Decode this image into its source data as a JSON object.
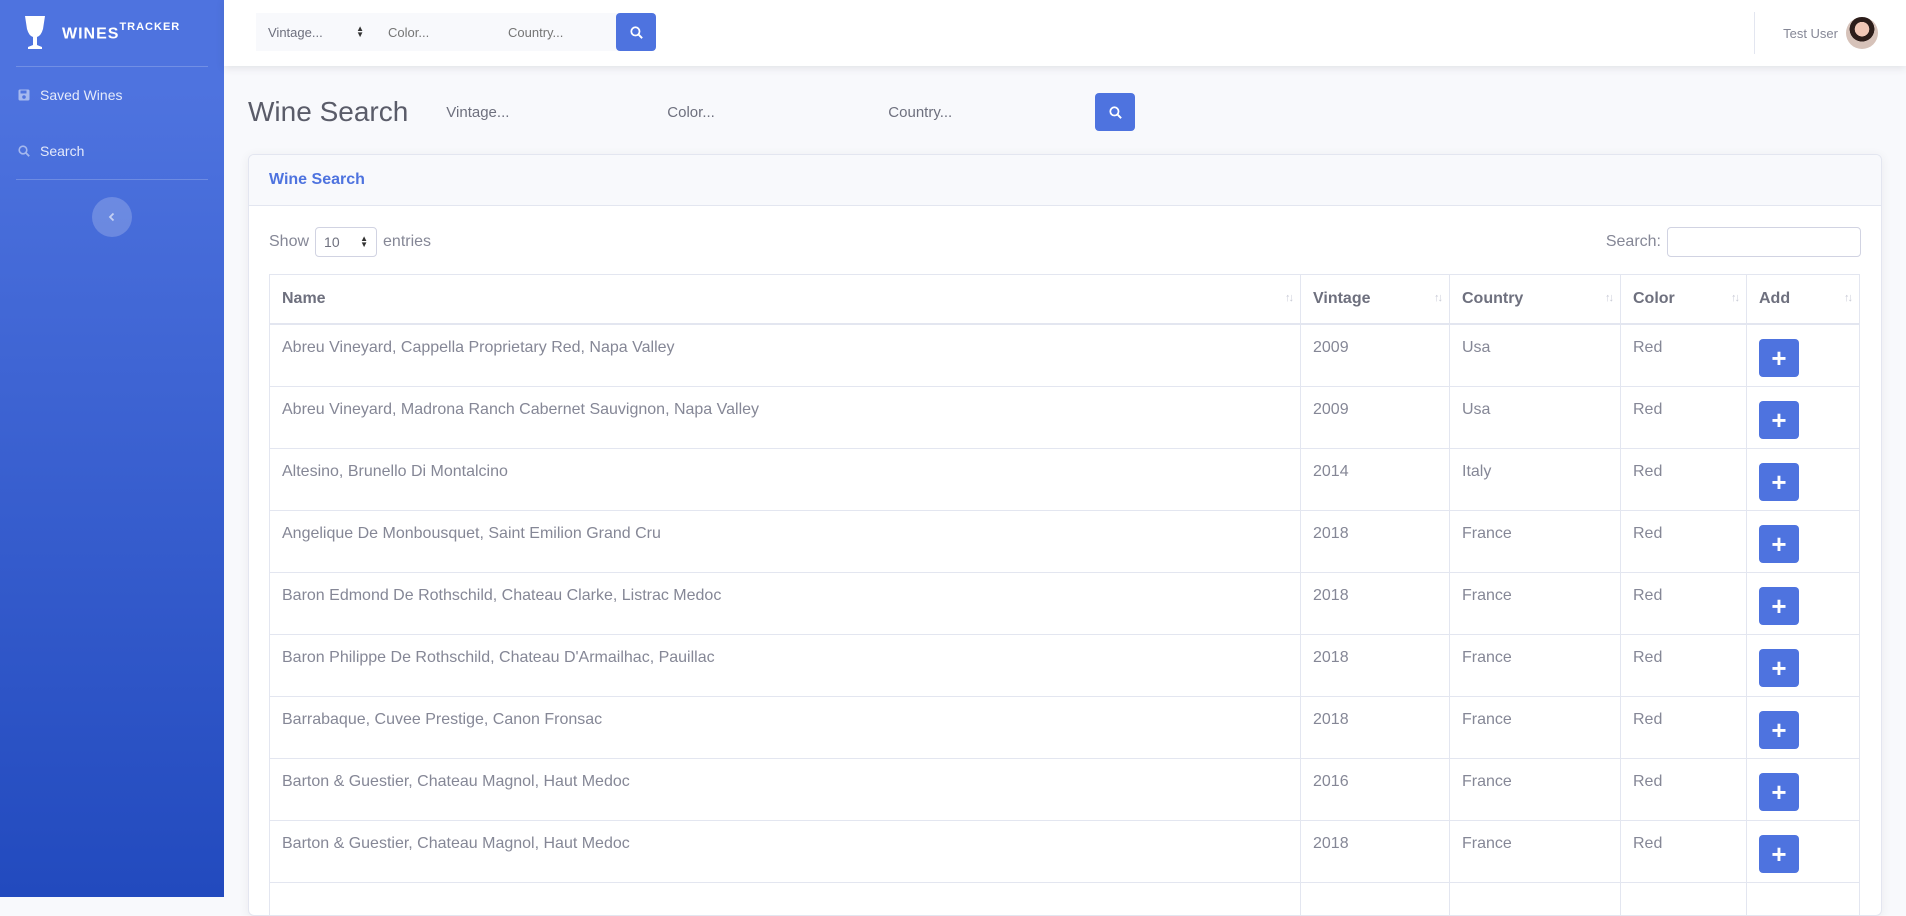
{
  "brand": {
    "name": "WINES",
    "sup": "TRACKER"
  },
  "sidebar": {
    "items": [
      {
        "label": "Saved Wines",
        "icon": "save-icon"
      },
      {
        "label": "Search",
        "icon": "search-icon"
      }
    ]
  },
  "topbar": {
    "vintage_placeholder": "Vintage...",
    "color_placeholder": "Color...",
    "country_placeholder": "Country...",
    "user_name": "Test User"
  },
  "heading": {
    "title": "Wine Search",
    "vintage_placeholder": "Vintage...",
    "color_placeholder": "Color...",
    "country_placeholder": "Country..."
  },
  "card": {
    "title": "Wine Search",
    "show_label": "Show",
    "entries_label": "entries",
    "page_length": "10",
    "search_label": "Search:"
  },
  "table": {
    "headers": [
      "Name",
      "Vintage",
      "Country",
      "Color",
      "Add"
    ],
    "rows": [
      {
        "name": "Abreu Vineyard, Cappella Proprietary Red, Napa Valley",
        "vintage": "2009",
        "country": "Usa",
        "color": "Red"
      },
      {
        "name": "Abreu Vineyard, Madrona Ranch Cabernet Sauvignon, Napa Valley",
        "vintage": "2009",
        "country": "Usa",
        "color": "Red"
      },
      {
        "name": "Altesino, Brunello Di Montalcino",
        "vintage": "2014",
        "country": "Italy",
        "color": "Red"
      },
      {
        "name": "Angelique De Monbousquet, Saint Emilion Grand Cru",
        "vintage": "2018",
        "country": "France",
        "color": "Red"
      },
      {
        "name": "Baron Edmond De Rothschild, Chateau Clarke, Listrac Medoc",
        "vintage": "2018",
        "country": "France",
        "color": "Red"
      },
      {
        "name": "Baron Philippe De Rothschild, Chateau D'Armailhac, Pauillac",
        "vintage": "2018",
        "country": "France",
        "color": "Red"
      },
      {
        "name": "Barrabaque, Cuvee Prestige, Canon Fronsac",
        "vintage": "2018",
        "country": "France",
        "color": "Red"
      },
      {
        "name": "Barton & Guestier, Chateau Magnol, Haut Medoc",
        "vintage": "2016",
        "country": "France",
        "color": "Red"
      },
      {
        "name": "Barton & Guestier, Chateau Magnol, Haut Medoc",
        "vintage": "2018",
        "country": "France",
        "color": "Red"
      }
    ],
    "add_label": "+"
  },
  "colors": {
    "primary": "#4e73df",
    "sidebar_end": "#224abe"
  }
}
